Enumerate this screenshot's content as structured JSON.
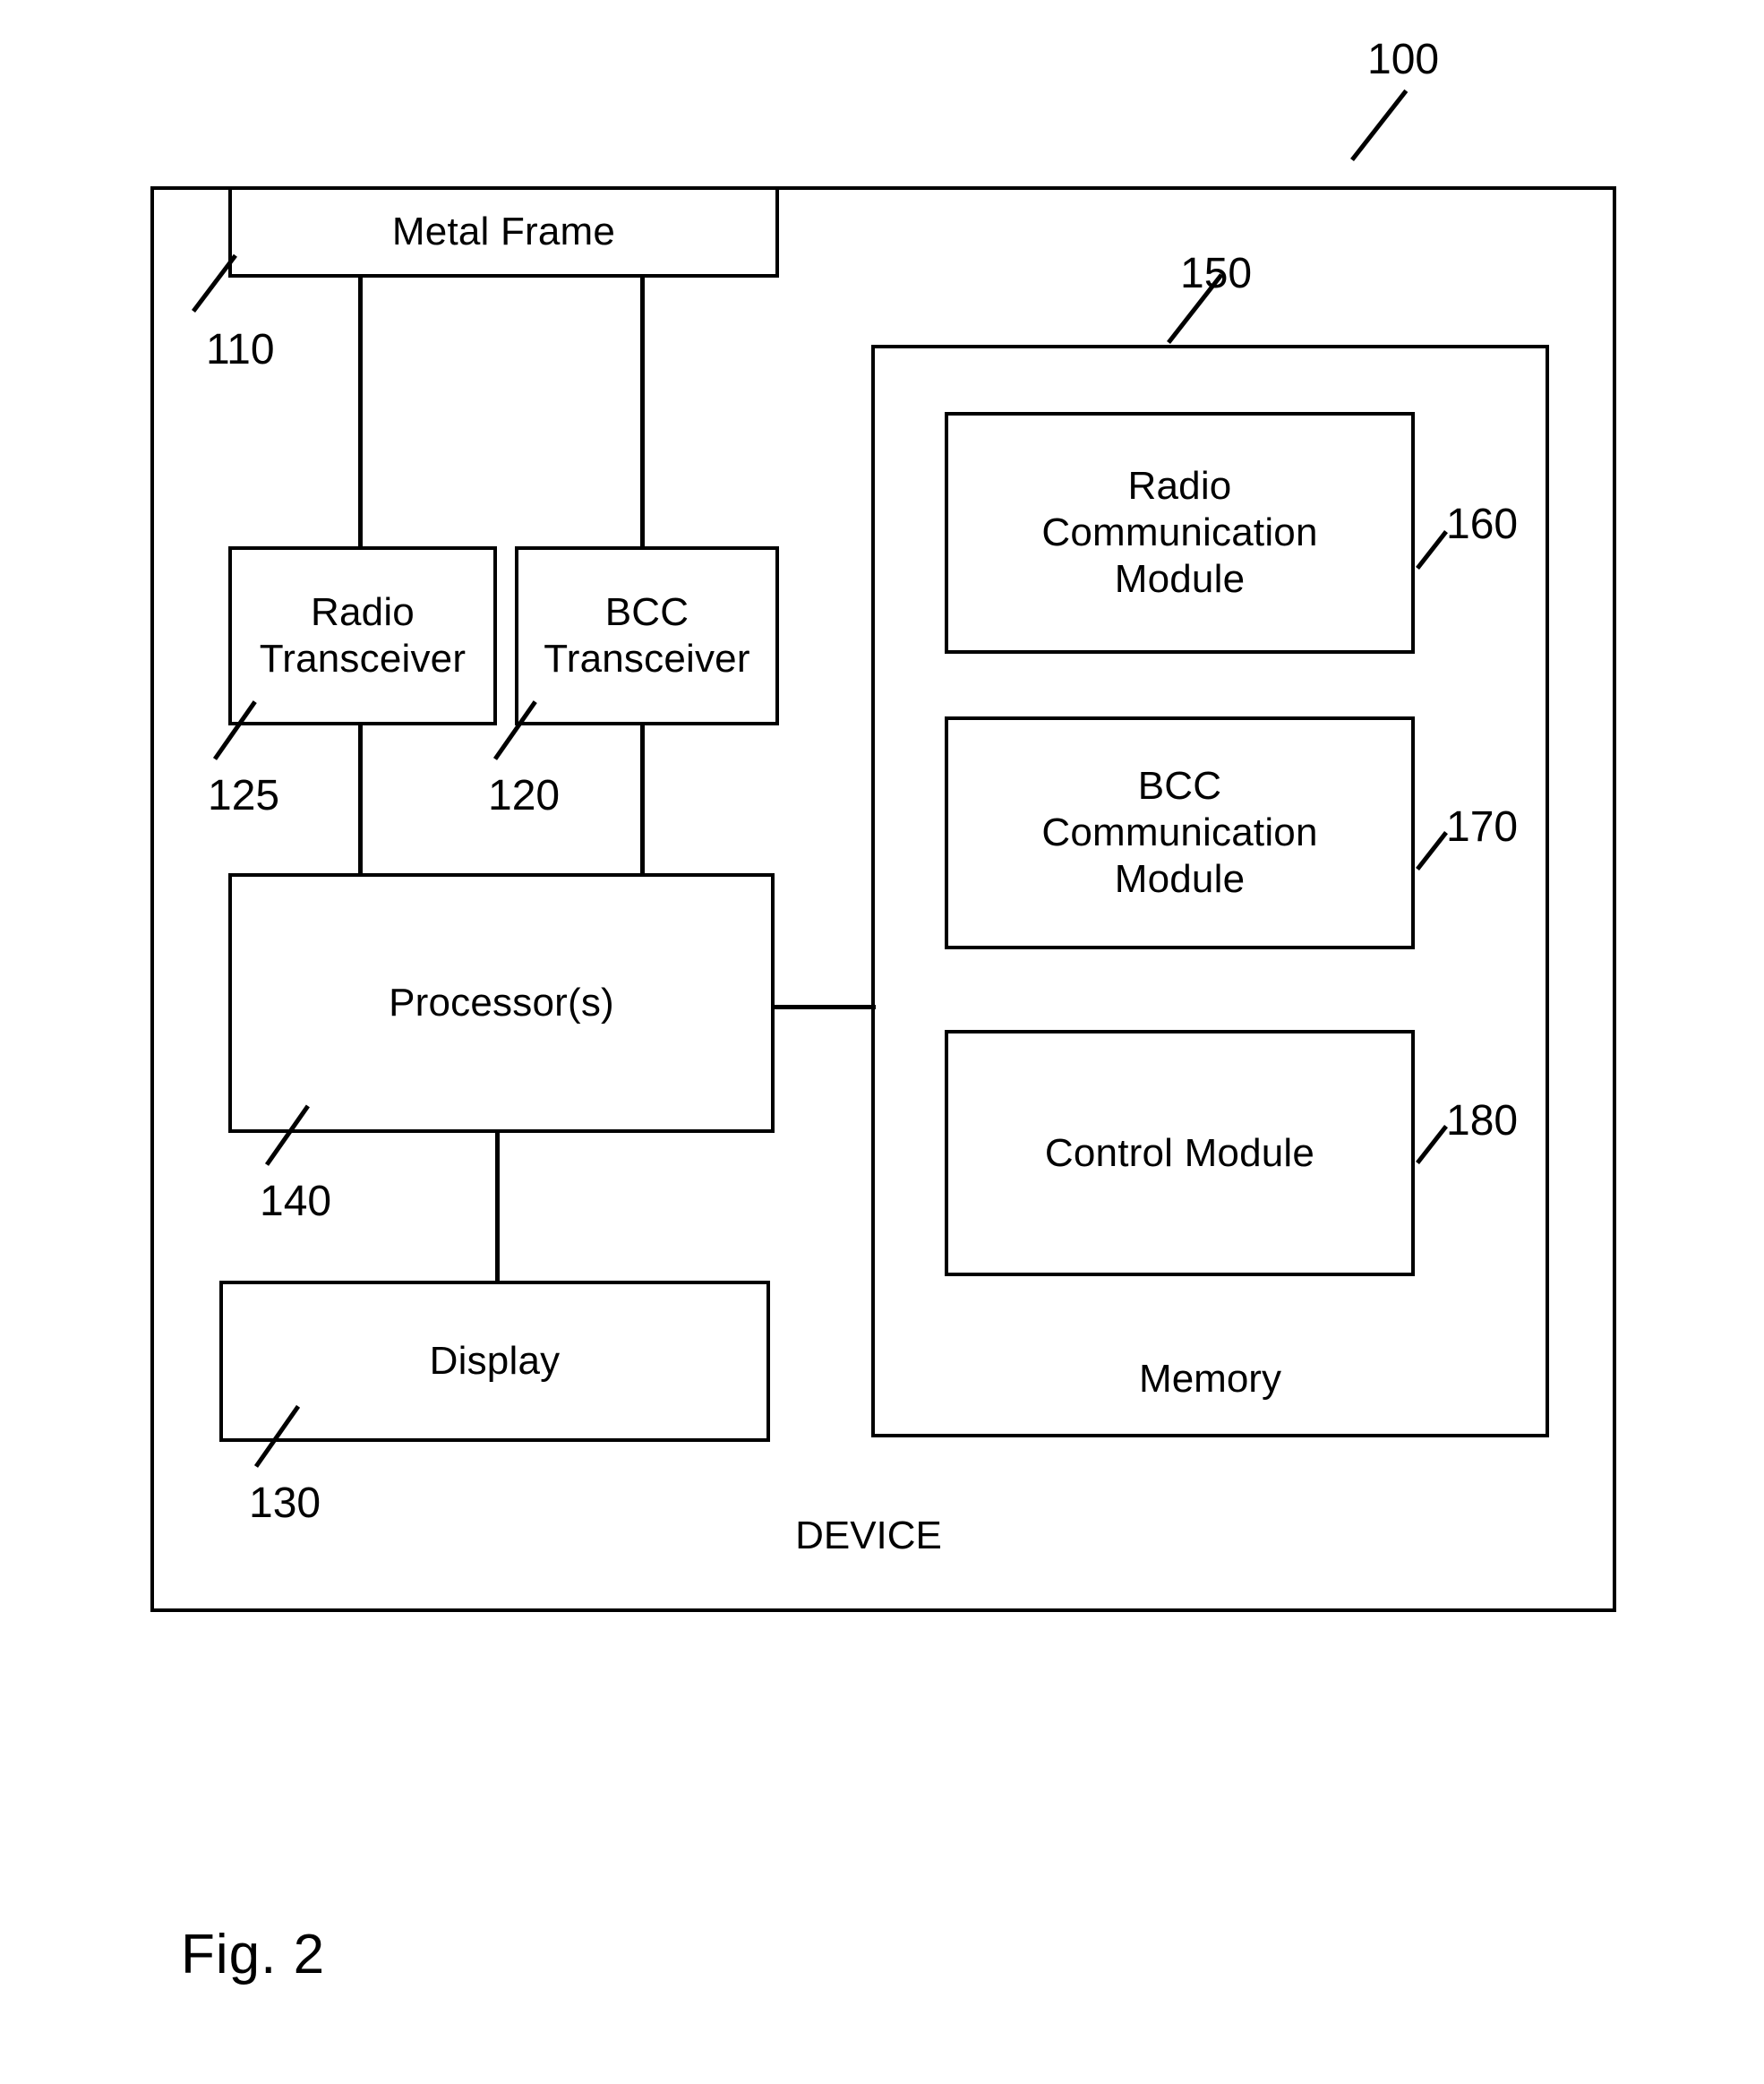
{
  "figure": {
    "caption": "Fig. 2"
  },
  "device": {
    "label": "DEVICE",
    "ref": "100"
  },
  "blocks": {
    "metal_frame": {
      "label": "Metal Frame",
      "ref": "110"
    },
    "radio_transceiver": {
      "label": "Radio\nTransceiver",
      "ref": "125"
    },
    "bcc_transceiver": {
      "label": "BCC\nTransceiver",
      "ref": "120"
    },
    "processor": {
      "label": "Processor(s)",
      "ref": "140"
    },
    "display": {
      "label": "Display",
      "ref": "130"
    },
    "memory": {
      "label": "Memory",
      "ref": "150"
    },
    "radio_communication_module": {
      "label": "Radio\nCommunication\nModule",
      "ref": "160"
    },
    "bcc_communication_module": {
      "label": "BCC\nCommunication\nModule",
      "ref": "170"
    },
    "control_module": {
      "label": "Control Module",
      "ref": "180"
    }
  },
  "style": {
    "line_color": "#000000",
    "background_color": "#ffffff"
  }
}
